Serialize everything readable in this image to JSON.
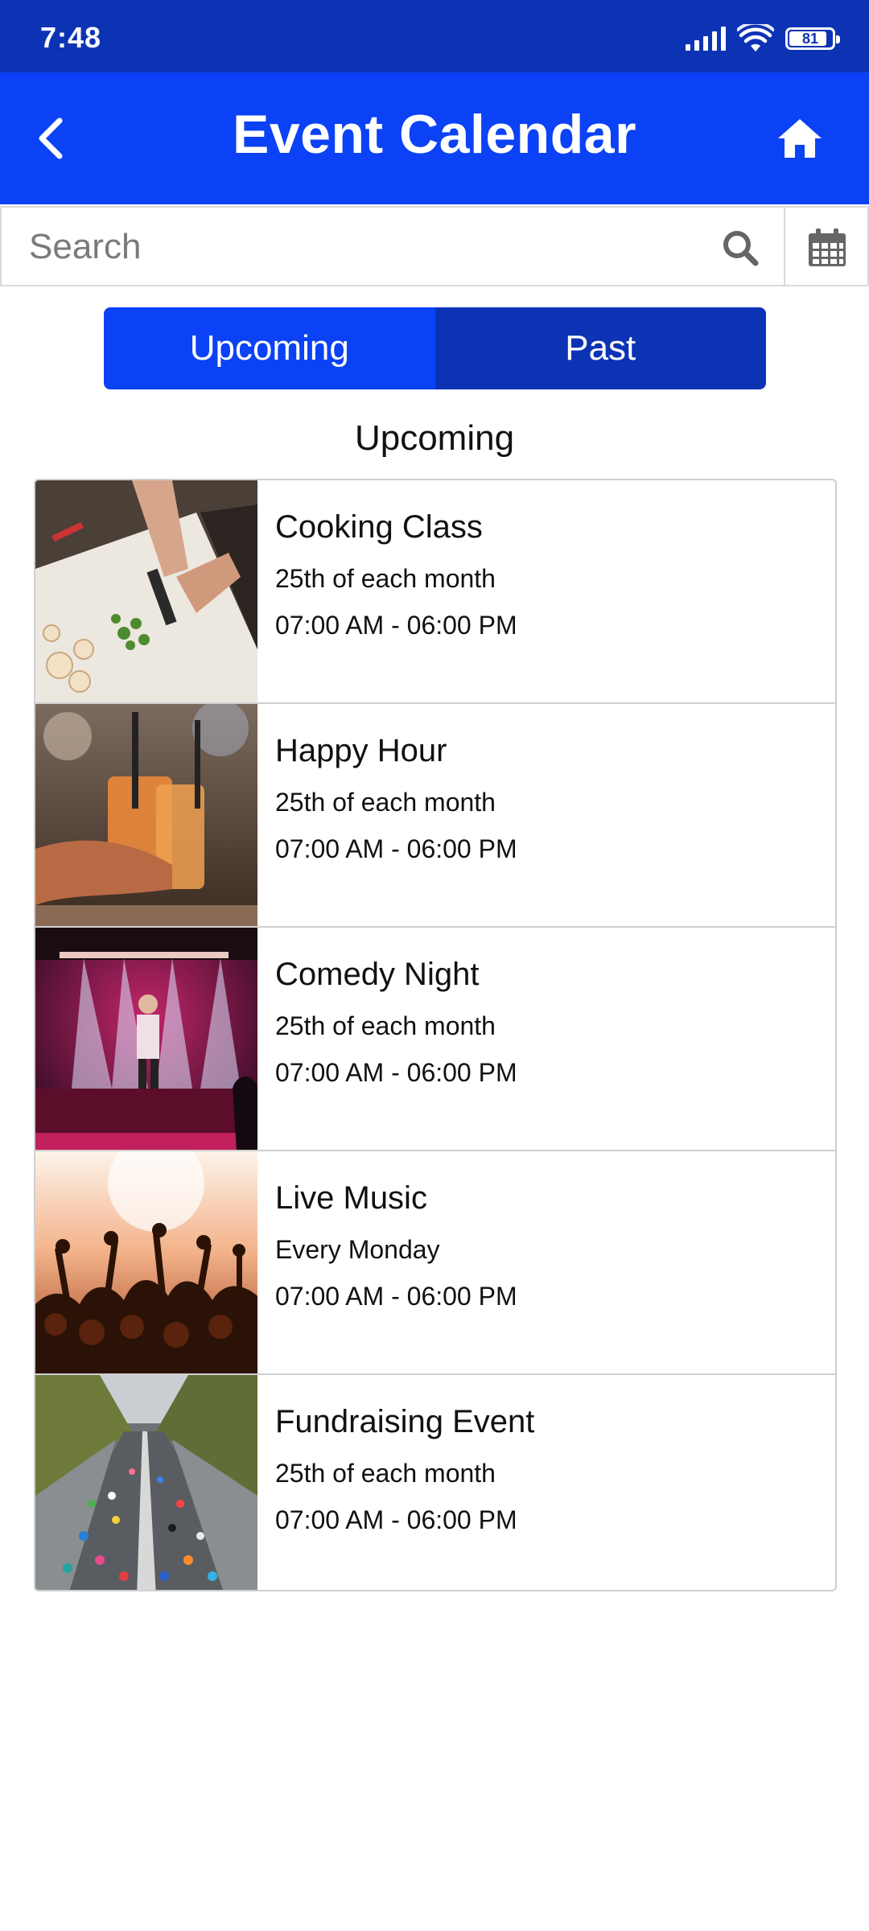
{
  "status_bar": {
    "time": "7:48",
    "battery": "81"
  },
  "app_bar": {
    "title": "Event Calendar"
  },
  "search": {
    "placeholder": "Search",
    "value": ""
  },
  "tabs": [
    {
      "label": "Upcoming",
      "selected": true
    },
    {
      "label": "Past",
      "selected": false
    }
  ],
  "section_title": "Upcoming",
  "events": [
    {
      "name": "Cooking Class",
      "recurrence": "25th of each month",
      "hours": "07:00 AM - 06:00 PM",
      "image": "cooking-photo"
    },
    {
      "name": "Happy Hour",
      "recurrence": "25th of each month",
      "hours": "07:00 AM - 06:00 PM",
      "image": "cocktail-photo"
    },
    {
      "name": "Comedy Night",
      "recurrence": "25th of each month",
      "hours": "07:00 AM - 06:00 PM",
      "image": "stage-photo"
    },
    {
      "name": "Live Music",
      "recurrence": "Every Monday",
      "hours": "07:00 AM - 06:00 PM",
      "image": "concert-crowd-photo"
    },
    {
      "name": "Fundraising Event",
      "recurrence": "25th of each month",
      "hours": "07:00 AM - 06:00 PM",
      "image": "marathon-runners-photo"
    }
  ],
  "colors": {
    "status_bar": "#0d33b5",
    "app_bar": "#0b42f5",
    "tab_active": "#0b42f5",
    "tab_inactive": "#0d33b5"
  },
  "icons": [
    "back-arrow-icon",
    "home-icon",
    "search-icon",
    "calendar-icon",
    "signal-icon",
    "wifi-icon",
    "battery-icon"
  ]
}
